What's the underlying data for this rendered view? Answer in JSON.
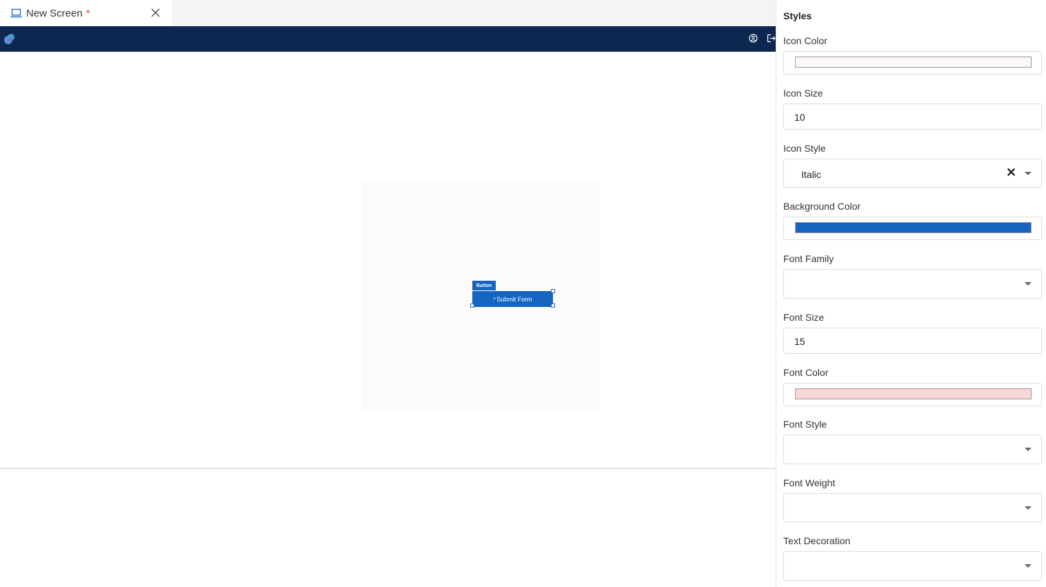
{
  "tab": {
    "title": "New Screen",
    "dirty_marker": "*"
  },
  "canvas": {
    "selected_component_type": "Button",
    "button_label": "Submit Form",
    "button_icon": "⌕"
  },
  "colors": {
    "appbar": "#0c2750",
    "accent": "#1565c0",
    "dirty": "#e0403a"
  },
  "styles_panel": {
    "title": "Styles",
    "icon_color": {
      "label": "Icon Color",
      "value": "#fdf7f7"
    },
    "icon_size": {
      "label": "Icon Size",
      "value": "10"
    },
    "icon_style": {
      "label": "Icon Style",
      "value": "Italic"
    },
    "background_color": {
      "label": "Background Color",
      "value": "#1565c0"
    },
    "font_family": {
      "label": "Font Family",
      "value": ""
    },
    "font_size": {
      "label": "Font Size",
      "value": "15"
    },
    "font_color": {
      "label": "Font Color",
      "value": "#f9d6d6"
    },
    "font_style": {
      "label": "Font Style",
      "value": ""
    },
    "font_weight": {
      "label": "Font Weight",
      "value": ""
    },
    "text_decoration": {
      "label": "Text Decoration",
      "value": ""
    }
  }
}
